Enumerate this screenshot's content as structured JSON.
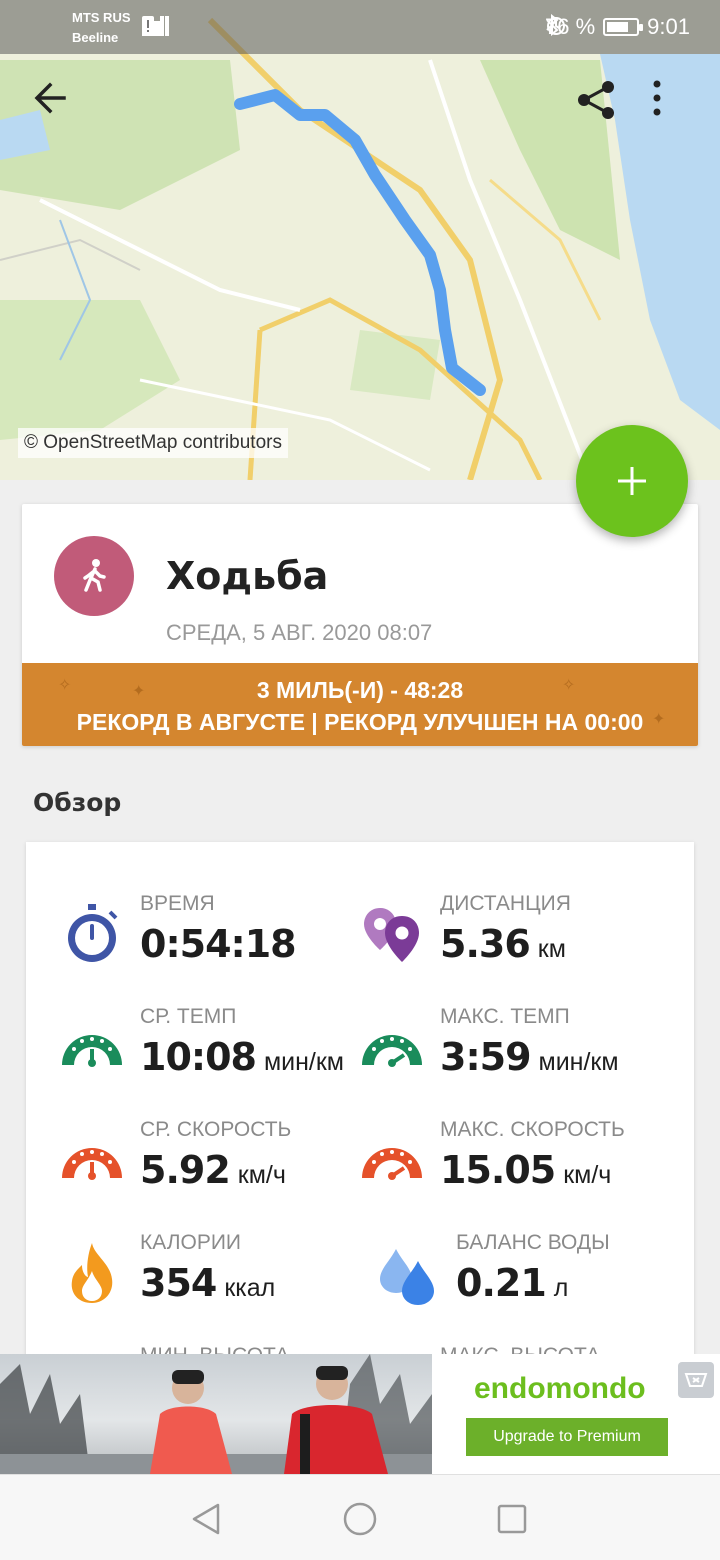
{
  "status_bar": {
    "carrier_1": "MTS RUS",
    "carrier_2": "Beeline",
    "battery_percent": "76 %",
    "battery_level": 0.76,
    "time": "9:01"
  },
  "map": {
    "attribution": "© OpenStreetMap contributors",
    "route_color": "#5aa0ee",
    "water_color": "#b9d9f2"
  },
  "toolbar": {
    "back_icon": "arrow-left-icon",
    "share_icon": "share-icon",
    "more_icon": "more-vert-icon"
  },
  "fab": {
    "icon": "plus-icon",
    "color": "#6cc21d"
  },
  "workout": {
    "sport": "Ходьба",
    "sport_icon": "walking-icon",
    "sport_color": "#c15b79",
    "date": "СРЕДА, 5 АВГ. 2020 08:07",
    "record_line1": "3 МИЛЬ(-И)  -  48:28",
    "record_line2": "РЕКОРД В АВГУСТЕ  |  РЕКОРД УЛУЧШЕН НА 00:00",
    "record_color": "#d4862f"
  },
  "overview": {
    "title": "Обзор",
    "stats": [
      {
        "label": "ВРЕМЯ",
        "value": "0:54:18",
        "unit": "",
        "icon": "stopwatch-icon"
      },
      {
        "label": "ДИСТАНЦИЯ",
        "value": "5.36",
        "unit": "км",
        "icon": "map-pins-icon"
      },
      {
        "label": "СР. ТЕМП",
        "value": "10:08",
        "unit": "мин/км",
        "icon": "avg-pace-gauge-icon"
      },
      {
        "label": "МАКС. ТЕМП",
        "value": "3:59",
        "unit": "мин/км",
        "icon": "max-pace-gauge-icon"
      },
      {
        "label": "СР. СКОРОСТЬ",
        "value": "5.92",
        "unit": "км/ч",
        "icon": "avg-speed-gauge-icon"
      },
      {
        "label": "МАКС. СКОРОСТЬ",
        "value": "15.05",
        "unit": "км/ч",
        "icon": "max-speed-gauge-icon"
      },
      {
        "label": "КАЛОРИИ",
        "value": "354",
        "unit": "ккал",
        "icon": "flame-icon"
      },
      {
        "label": "БАЛАНС ВОДЫ",
        "value": "0.21",
        "unit": "л",
        "icon": "water-drops-icon"
      }
    ],
    "partial_labels": [
      "МИН. ВЫСОТА",
      "МАКС. ВЫСОТА"
    ]
  },
  "ad": {
    "brand": "endomondo",
    "button": "Upgrade to Premium",
    "close_icon": "ad-close-icon"
  },
  "nav": {
    "back_icon": "nav-back-icon",
    "home_icon": "nav-home-icon",
    "recents_icon": "nav-recents-icon"
  }
}
